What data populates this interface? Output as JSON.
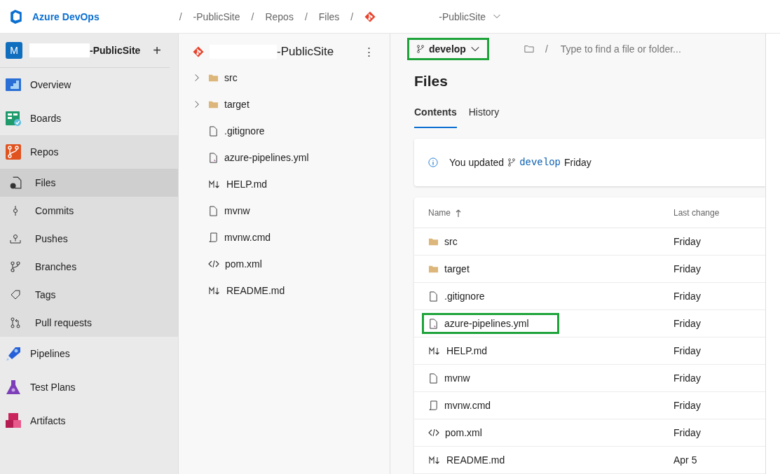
{
  "header": {
    "product": "Azure DevOps",
    "breadcrumbs": [
      {
        "kind": "redacted"
      },
      {
        "kind": "separator",
        "text": "/"
      },
      {
        "kind": "crumb",
        "text": "-PublicSite"
      },
      {
        "kind": "separator",
        "text": "/"
      },
      {
        "kind": "crumb",
        "text": "Repos"
      },
      {
        "kind": "separator",
        "text": "/"
      },
      {
        "kind": "crumb",
        "text": "Files"
      },
      {
        "kind": "separator",
        "text": "/"
      },
      {
        "kind": "repo",
        "text": "-PublicSite"
      }
    ]
  },
  "sidebar": {
    "project": {
      "avatar": "M",
      "name": "-PublicSite",
      "add": "+"
    },
    "items": [
      {
        "label": "Overview",
        "kind": "overview",
        "selected": false,
        "in_group": false
      },
      {
        "label": "Boards",
        "kind": "boards",
        "selected": false,
        "in_group": false
      },
      {
        "label": "Repos",
        "kind": "repos",
        "selected": false,
        "in_group": true
      },
      {
        "label": "Files",
        "kind": "files",
        "selected": true,
        "in_group": true
      },
      {
        "label": "Commits",
        "kind": "commits",
        "selected": false,
        "in_group": true
      },
      {
        "label": "Pushes",
        "kind": "pushes",
        "selected": false,
        "in_group": true
      },
      {
        "label": "Branches",
        "kind": "branches",
        "selected": false,
        "in_group": true
      },
      {
        "label": "Tags",
        "kind": "tags",
        "selected": false,
        "in_group": true
      },
      {
        "label": "Pull requests",
        "kind": "pulls",
        "selected": false,
        "in_group": true
      },
      {
        "label": "Pipelines",
        "kind": "pipelines",
        "selected": false,
        "in_group": false
      },
      {
        "label": "Test Plans",
        "kind": "testplans",
        "selected": false,
        "in_group": false
      },
      {
        "label": "Artifacts",
        "kind": "artifacts",
        "selected": false,
        "in_group": false
      }
    ]
  },
  "tree": {
    "repo": "-PublicSite",
    "more": "⋮",
    "items": [
      {
        "name": "src",
        "kind": "folder",
        "expanded": false
      },
      {
        "name": "target",
        "kind": "folder",
        "expanded": false
      },
      {
        "name": ".gitignore",
        "kind": "file"
      },
      {
        "name": "azure-pipelines.yml",
        "kind": "yaml"
      },
      {
        "name": "HELP.md",
        "kind": "markdown"
      },
      {
        "name": "mvnw",
        "kind": "file"
      },
      {
        "name": "mvnw.cmd",
        "kind": "script"
      },
      {
        "name": "pom.xml",
        "kind": "code"
      },
      {
        "name": "README.md",
        "kind": "markdown"
      }
    ]
  },
  "main": {
    "branch": {
      "name": "develop",
      "highlighted": true
    },
    "path_separator": "/",
    "path_placeholder": "Type to find a file or folder...",
    "title": "Files",
    "tabs": [
      {
        "label": "Contents",
        "selected": true
      },
      {
        "label": "History",
        "selected": false
      }
    ],
    "notice": {
      "text": "You updated",
      "branch": "develop",
      "when": "Friday"
    },
    "table": {
      "columns": [
        "Name",
        "Last change"
      ],
      "rows": [
        {
          "name": "src",
          "kind": "folder",
          "last_change": "Friday",
          "highlighted": false
        },
        {
          "name": "target",
          "kind": "folder",
          "last_change": "Friday",
          "highlighted": false
        },
        {
          "name": ".gitignore",
          "kind": "file",
          "last_change": "Friday",
          "highlighted": false
        },
        {
          "name": "azure-pipelines.yml",
          "kind": "yaml",
          "last_change": "Friday",
          "highlighted": true
        },
        {
          "name": "HELP.md",
          "kind": "markdown",
          "last_change": "Friday",
          "highlighted": false
        },
        {
          "name": "mvnw",
          "kind": "file",
          "last_change": "Friday",
          "highlighted": false
        },
        {
          "name": "mvnw.cmd",
          "kind": "script",
          "last_change": "Friday",
          "highlighted": false
        },
        {
          "name": "pom.xml",
          "kind": "code",
          "last_change": "Friday",
          "highlighted": false
        },
        {
          "name": "README.md",
          "kind": "markdown",
          "last_change": "Apr 5",
          "highlighted": false
        }
      ]
    }
  }
}
